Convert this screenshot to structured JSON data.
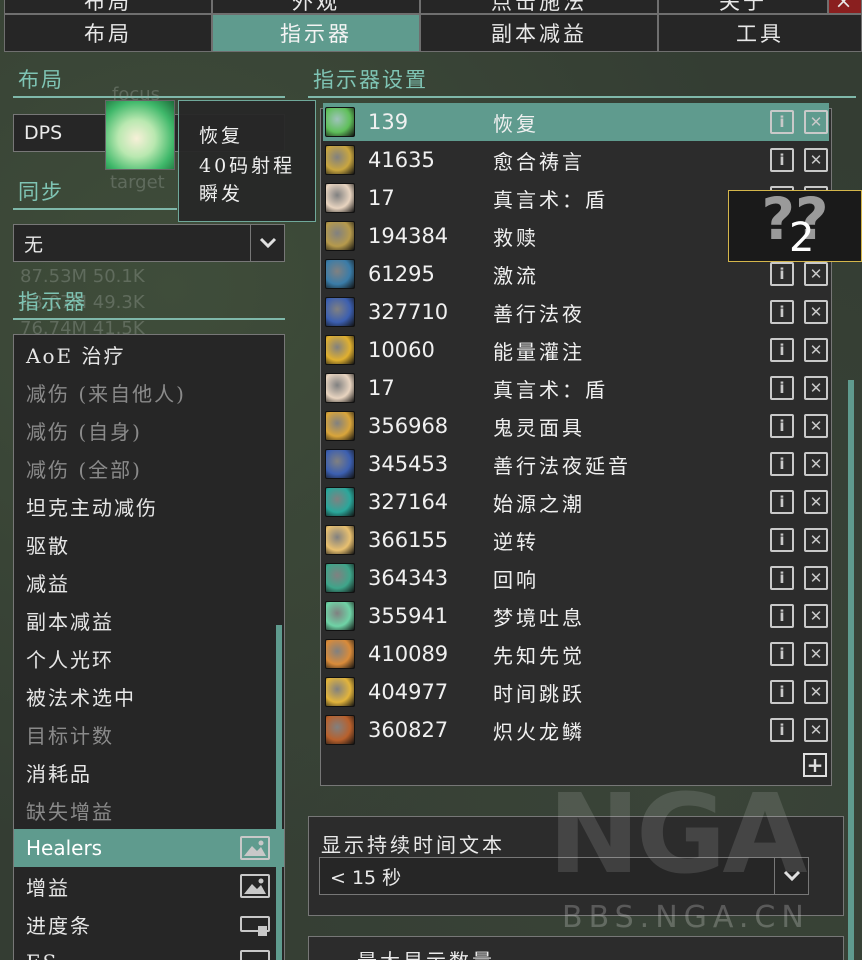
{
  "top_tabs_row": [
    "布局",
    "外观",
    "点击施法",
    "关于",
    "×"
  ],
  "tabs": [
    {
      "label": "布局",
      "active": false
    },
    {
      "label": "指示器",
      "active": true
    },
    {
      "label": "副本减益",
      "active": false
    },
    {
      "label": "工具",
      "active": false
    }
  ],
  "left": {
    "layout_title": "布局",
    "layout_value": "DPS",
    "sync_title": "同步",
    "sync_value": "无",
    "indicators_title": "指示器",
    "items": [
      {
        "label": "AoE 治疗",
        "state": "normal"
      },
      {
        "label": "减伤 (来自他人)",
        "state": "dim"
      },
      {
        "label": "减伤 (自身)",
        "state": "dim"
      },
      {
        "label": "减伤 (全部)",
        "state": "dim"
      },
      {
        "label": "坦克主动减伤",
        "state": "normal"
      },
      {
        "label": "驱散",
        "state": "normal"
      },
      {
        "label": "减益",
        "state": "normal"
      },
      {
        "label": "副本减益",
        "state": "normal"
      },
      {
        "label": "个人光环",
        "state": "normal"
      },
      {
        "label": "被法术选中",
        "state": "normal"
      },
      {
        "label": "目标计数",
        "state": "dim"
      },
      {
        "label": "消耗品",
        "state": "normal"
      },
      {
        "label": "缺失增益",
        "state": "dim"
      },
      {
        "label": "Healers",
        "state": "active",
        "icon": "image-icon"
      },
      {
        "label": "增益",
        "state": "normal",
        "icon": "image-icon"
      },
      {
        "label": "进度条",
        "state": "normal",
        "icon": "bar-icon"
      },
      {
        "label": "ES",
        "state": "normal",
        "icon": "image-icon"
      }
    ]
  },
  "tooltip": {
    "line1": "恢复",
    "line2": "40码射程",
    "line3": "瞬发",
    "ghost_texts": [
      "focus",
      "target",
      "87.53M 50.1K",
      "43.07M 49.3K",
      "76.74M 41.5K"
    ]
  },
  "right": {
    "title": "指示器设置",
    "spells": [
      {
        "id": "139",
        "name": "恢复",
        "color": "#5fbf5a",
        "selected": true
      },
      {
        "id": "41635",
        "name": "愈合祷言",
        "color": "#c9a640"
      },
      {
        "id": "17",
        "name": "真言术：盾",
        "color": "#e8d4c0"
      },
      {
        "id": "194384",
        "name": "救赎",
        "color": "#b69a4c"
      },
      {
        "id": "61295",
        "name": "激流",
        "color": "#3a7ca8"
      },
      {
        "id": "327710",
        "name": "善行法夜",
        "color": "#3c5fb0"
      },
      {
        "id": "10060",
        "name": "能量灌注",
        "color": "#e0b030"
      },
      {
        "id": "17",
        "name": "真言术：盾",
        "color": "#e8d4c0"
      },
      {
        "id": "356968",
        "name": "鬼灵面具",
        "color": "#d9a53b"
      },
      {
        "id": "345453",
        "name": "善行法夜延音",
        "color": "#3c5fb0"
      },
      {
        "id": "327164",
        "name": "始源之潮",
        "color": "#2aa79b"
      },
      {
        "id": "366155",
        "name": "逆转",
        "color": "#e8c070"
      },
      {
        "id": "364343",
        "name": "回响",
        "color": "#3ea58a"
      },
      {
        "id": "355941",
        "name": "梦境吐息",
        "color": "#6fd3a6"
      },
      {
        "id": "410089",
        "name": "先知先觉",
        "color": "#d98b3a"
      },
      {
        "id": "404977",
        "name": "时间跳跃",
        "color": "#e2b43c"
      },
      {
        "id": "360827",
        "name": "炽火龙鳞",
        "color": "#b8602c"
      }
    ],
    "duration_label": "显示持续时间文本",
    "duration_value": "< 15 秒",
    "max_label": "最大显示数量"
  },
  "mystery": {
    "marks": "??",
    "count": "2"
  },
  "watermark": {
    "brand": "NGA",
    "url": "BBS.NGA.CN"
  }
}
